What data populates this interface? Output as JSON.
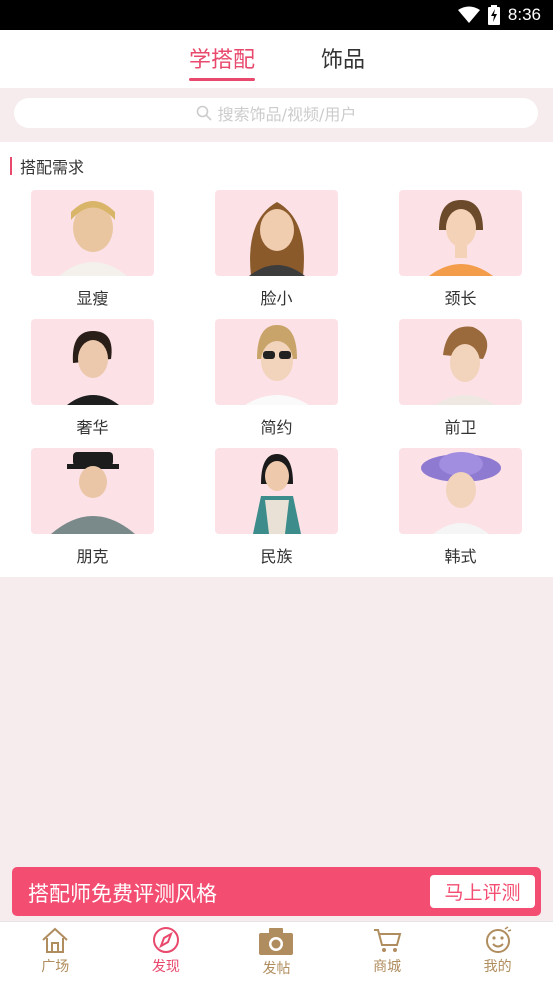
{
  "status_bar": {
    "time": "8:36",
    "icons": [
      "wifi-icon",
      "battery-charging-icon"
    ]
  },
  "header": {
    "tabs": [
      {
        "label": "学搭配",
        "active": true
      },
      {
        "label": "饰品",
        "active": false
      }
    ]
  },
  "search": {
    "placeholder": "搜索饰品/视频/用户",
    "icon": "search-icon"
  },
  "section": {
    "title": "搭配需求"
  },
  "styles": [
    {
      "label": "显瘦"
    },
    {
      "label": "脸小"
    },
    {
      "label": "颈长"
    },
    {
      "label": "奢华"
    },
    {
      "label": "简约"
    },
    {
      "label": "前卫"
    },
    {
      "label": "朋克"
    },
    {
      "label": "民族"
    },
    {
      "label": "韩式"
    }
  ],
  "banner": {
    "text": "搭配师免费评测风格",
    "button": "马上评测"
  },
  "tabbar": {
    "items": [
      {
        "label": "广场",
        "icon": "home-icon",
        "active": false
      },
      {
        "label": "发现",
        "icon": "compass-icon",
        "active": true
      },
      {
        "label": "发帖",
        "icon": "camera-icon",
        "active": false
      },
      {
        "label": "商城",
        "icon": "cart-icon",
        "active": false
      },
      {
        "label": "我的",
        "icon": "smiley-icon",
        "active": false
      }
    ]
  },
  "colors": {
    "accent": "#e8496d",
    "banner": "#f34e72",
    "card_bg": "#fce1e6",
    "page_bg": "#f6eced",
    "tab_inactive": "#b08d5e"
  }
}
